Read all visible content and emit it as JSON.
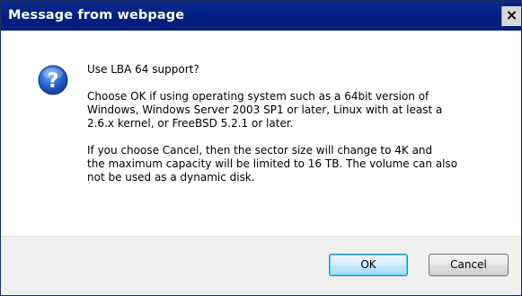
{
  "window": {
    "title": "Message from webpage",
    "close_glyph": "×"
  },
  "icon": {
    "name": "question-icon",
    "glyph": "?",
    "color": "#2158c9"
  },
  "message": {
    "question": "Use LBA 64 support?",
    "ok_paragraph": [
      "Choose OK if using operating system such as a 64bit version of",
      "Windows, Windows Server 2003 SP1 or later, Linux with at least a",
      "2.6.x kernel, or FreeBSD 5.2.1 or later."
    ],
    "cancel_paragraph": [
      "If you choose Cancel, then the sector size will change to 4K and",
      "the maximum capacity will be limited to 16 TB. The volume can also",
      "not be used as a dynamic disk."
    ]
  },
  "buttons": {
    "ok_label": "OK",
    "cancel_label": "Cancel"
  }
}
